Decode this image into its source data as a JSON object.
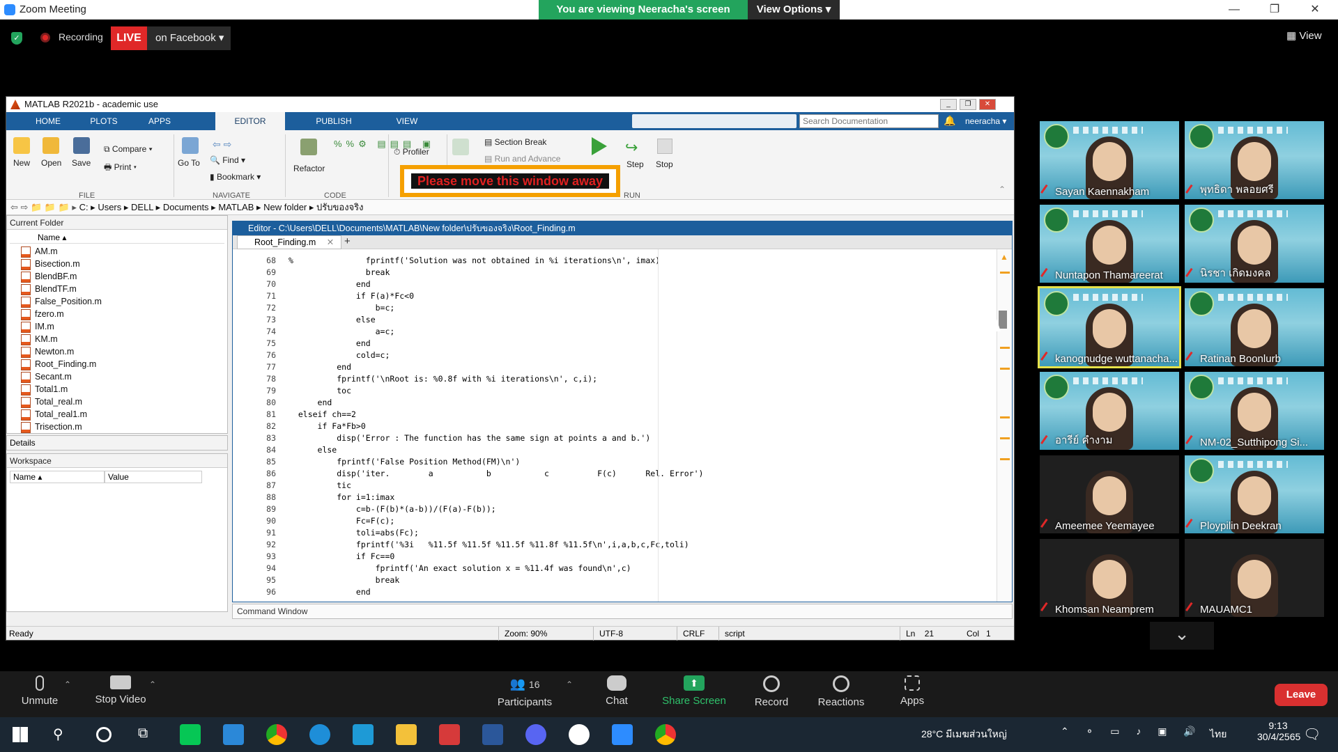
{
  "zoom": {
    "window_title": "Zoom Meeting",
    "viewing_banner": "You are viewing Neeracha's screen",
    "view_options": "View Options ▾",
    "recording_label": "Recording",
    "live_label": "LIVE",
    "live_target": "on Facebook ▾",
    "view_button": "View",
    "window_buttons": {
      "minimize": "—",
      "restore": "❐",
      "close": "✕"
    }
  },
  "matlab": {
    "window_title": "MATLAB R2021b - academic use",
    "tabs": [
      "HOME",
      "PLOTS",
      "APPS",
      "EDITOR",
      "PUBLISH",
      "VIEW"
    ],
    "active_tab": "EDITOR",
    "search_placeholder": "Search Documentation",
    "user": "neeracha ▾",
    "ribbon": {
      "new": "New",
      "open": "Open",
      "save": "Save",
      "compare": "Compare ▾",
      "print": "Print ▾",
      "go_to": "Go To",
      "find": "Find ▾",
      "bookmark": "Bookmark ▾",
      "refactor": "Refactor",
      "profiler": "Profiler",
      "section_break": "Section Break",
      "run_and_advance": "Run and Advance",
      "step": "Step",
      "stop": "Stop",
      "groups": {
        "file": "FILE",
        "navigate": "NAVIGATE",
        "code": "CODE",
        "run": "RUN"
      }
    },
    "address": [
      "C:",
      "Users",
      "DELL",
      "Documents",
      "MATLAB",
      "New folder",
      "ปรับของจริง"
    ],
    "current_folder": {
      "title": "Current Folder",
      "column": "Name ▴",
      "files": [
        "AM.m",
        "Bisection.m",
        "BlendBF.m",
        "BlendTF.m",
        "False_Position.m",
        "fzero.m",
        "IM.m",
        "KM.m",
        "Newton.m",
        "Root_Finding.m",
        "Secant.m",
        "Total1.m",
        "Total_real.m",
        "Total_real1.m",
        "Trisection.m"
      ]
    },
    "details_label": "Details",
    "workspace": {
      "title": "Workspace",
      "col_name": "Name ▴",
      "col_value": "Value"
    },
    "editor": {
      "title": "Editor - C:\\Users\\DELL\\Documents\\MATLAB\\New folder\\ปรับของจริง\\Root_Finding.m",
      "tab": "Root_Finding.m",
      "add_tab": "+",
      "lines": [
        {
          "n": "68",
          "code": "%               fprintf('Solution was not obtained in %i iterations\\n', imax)"
        },
        {
          "n": "69",
          "code": "                break"
        },
        {
          "n": "70",
          "code": "              end"
        },
        {
          "n": "71",
          "code": "              if F(a)*Fc<0"
        },
        {
          "n": "72",
          "code": "                  b=c;"
        },
        {
          "n": "73",
          "code": "              else"
        },
        {
          "n": "74",
          "code": "                  a=c;"
        },
        {
          "n": "75",
          "code": "              end"
        },
        {
          "n": "76",
          "code": "              cold=c;"
        },
        {
          "n": "77",
          "code": "          end"
        },
        {
          "n": "78",
          "code": "          fprintf('\\nRoot is: %0.8f with %i iterations\\n', c,i);"
        },
        {
          "n": "79",
          "code": "          toc"
        },
        {
          "n": "80",
          "code": "      end"
        },
        {
          "n": "81",
          "code": "  elseif ch==2"
        },
        {
          "n": "82",
          "code": "      if Fa*Fb>0"
        },
        {
          "n": "83",
          "code": "          disp('Error : The function has the same sign at points a and b.')"
        },
        {
          "n": "84",
          "code": "      else"
        },
        {
          "n": "85",
          "code": "          fprintf('False Position Method(FM)\\n')"
        },
        {
          "n": "86",
          "code": "          disp('iter.        a           b           c          F(c)      Rel. Error')"
        },
        {
          "n": "87",
          "code": "          tic"
        },
        {
          "n": "88",
          "code": "          for i=1:imax"
        },
        {
          "n": "89",
          "code": "              c=b-(F(b)*(a-b))/(F(a)-F(b));"
        },
        {
          "n": "90",
          "code": "              Fc=F(c);"
        },
        {
          "n": "91",
          "code": "              toli=abs(Fc);"
        },
        {
          "n": "92",
          "code": "              fprintf('%3i   %11.5f %11.5f %11.5f %11.8f %11.5f\\n',i,a,b,c,Fc,toli)"
        },
        {
          "n": "93",
          "code": "              if Fc==0"
        },
        {
          "n": "94",
          "code": "                  fprintf('An exact solution x = %11.4f was found\\n',c)"
        },
        {
          "n": "95",
          "code": "                  break"
        },
        {
          "n": "96",
          "code": "              end"
        }
      ]
    },
    "command_window": "Command Window",
    "status": {
      "ready": "Ready",
      "zoom": "Zoom: 90%",
      "encoding": "UTF-8",
      "eol": "CRLF",
      "mode": "script",
      "ln_label": "Ln",
      "ln": "21",
      "col_label": "Col",
      "col": "1"
    }
  },
  "overlay_banner": "Please move this window away",
  "participants_tiles": [
    {
      "name": "Sayan Kaennakham",
      "speaking": false
    },
    {
      "name": "พุทธิดา พลอยศรี",
      "speaking": false
    },
    {
      "name": "Nuntapon Thamareerat",
      "speaking": false
    },
    {
      "name": "นิรชา เกิดมงคล",
      "speaking": false
    },
    {
      "name": "kanognudge wuttanacha...",
      "speaking": true
    },
    {
      "name": "Ratinan Boonlurb",
      "speaking": false
    },
    {
      "name": "อารีย์ คำงาม",
      "speaking": false
    },
    {
      "name": "NM-02_Sutthipong Si...",
      "speaking": false
    },
    {
      "name": "Ameemee Yeemayee",
      "speaking": false
    },
    {
      "name": "Ploypilin Deekran",
      "speaking": false
    },
    {
      "name": "Khomsan Neamprem",
      "speaking": false
    },
    {
      "name": "MAUAMC1",
      "speaking": false
    }
  ],
  "gallery_more": "⌄",
  "toolbar": {
    "unmute": "Unmute",
    "stop_video": "Stop Video",
    "participants": "Participants",
    "participants_count": "16",
    "chat": "Chat",
    "share_screen": "Share Screen",
    "record": "Record",
    "reactions": "Reactions",
    "apps": "Apps",
    "leave": "Leave"
  },
  "taskbar": {
    "weather": "28°C  มีเมฆส่วนใหญ่",
    "lang": "ไทย",
    "time": "9:13",
    "date": "30/4/2565"
  },
  "colors": {
    "zoom_green": "#23a45d",
    "live_red": "#e02828",
    "matlab_blue": "#1c5e9c",
    "banner_orange": "#f5a000"
  }
}
